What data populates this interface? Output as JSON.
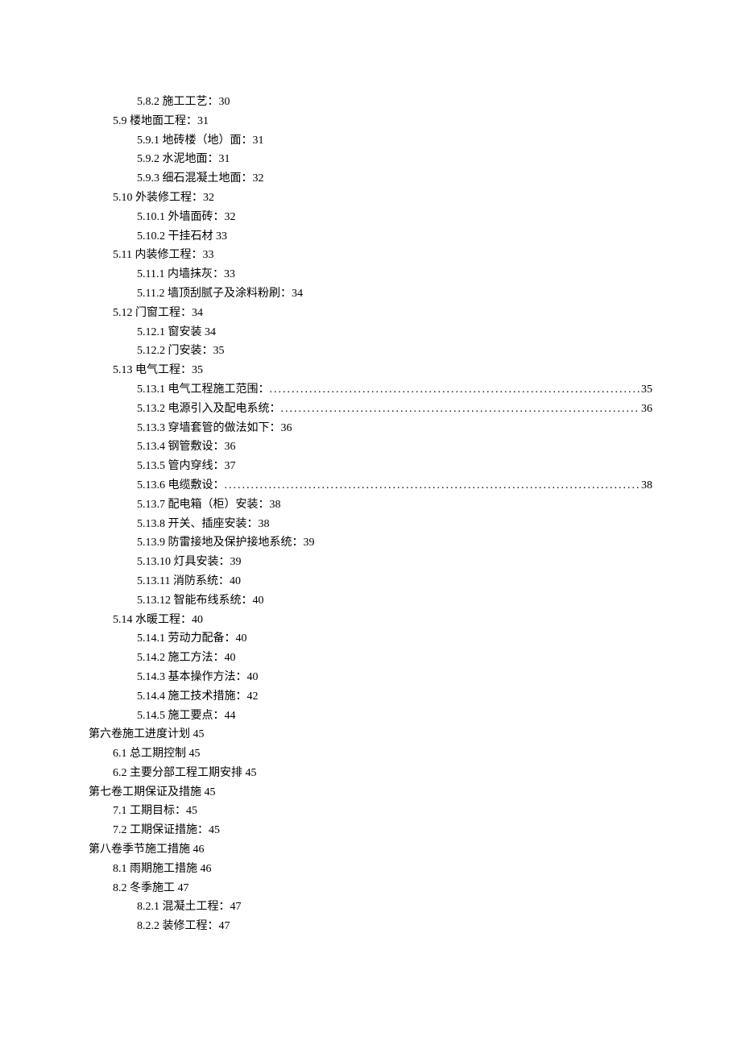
{
  "toc": [
    {
      "level": 2,
      "text": "5.8.2 施工工艺：30",
      "dotted": false,
      "page": ""
    },
    {
      "level": 1,
      "text": "5.9 楼地面工程：31",
      "dotted": false,
      "page": ""
    },
    {
      "level": 2,
      "text": "5.9.1 地砖楼（地）面：31",
      "dotted": false,
      "page": ""
    },
    {
      "level": 2,
      "text": "5.9.2 水泥地面：31",
      "dotted": false,
      "page": ""
    },
    {
      "level": 2,
      "text": "5.9.3 细石混凝土地面：32",
      "dotted": false,
      "page": ""
    },
    {
      "level": 1,
      "text": "5.10 外装修工程：32",
      "dotted": false,
      "page": ""
    },
    {
      "level": 2,
      "text": "5.10.1 外墙面砖：32",
      "dotted": false,
      "page": ""
    },
    {
      "level": 2,
      "text": "5.10.2 干挂石材 33",
      "dotted": false,
      "page": ""
    },
    {
      "level": 1,
      "text": "5.11 内装修工程：33",
      "dotted": false,
      "page": ""
    },
    {
      "level": 2,
      "text": "5.11.1 内墙抹灰：33",
      "dotted": false,
      "page": ""
    },
    {
      "level": 2,
      "text": "5.11.2 墙顶刮腻子及涂料粉刷：34",
      "dotted": false,
      "page": ""
    },
    {
      "level": 1,
      "text": "5.12 门窗工程：34",
      "dotted": false,
      "page": ""
    },
    {
      "level": 2,
      "text": "5.12.1 窗安装 34",
      "dotted": false,
      "page": ""
    },
    {
      "level": 2,
      "text": "5.12.2 门安装：35",
      "dotted": false,
      "page": ""
    },
    {
      "level": 1,
      "text": "5.13 电气工程：35",
      "dotted": false,
      "page": ""
    },
    {
      "level": 2,
      "text": "5.13.1 电气工程施工范围：",
      "dotted": true,
      "page": "35"
    },
    {
      "level": 2,
      "text": "5.13.2 电源引入及配电系统：",
      "dotted": true,
      "page": "36"
    },
    {
      "level": 2,
      "text": "5.13.3 穿墙套管的做法如下：36",
      "dotted": false,
      "page": ""
    },
    {
      "level": 2,
      "text": "5.13.4 钢管敷设：36",
      "dotted": false,
      "page": ""
    },
    {
      "level": 2,
      "text": "5.13.5 管内穿线：37",
      "dotted": false,
      "page": ""
    },
    {
      "level": 2,
      "text": "5.13.6 电缆敷设：",
      "dotted": true,
      "page": "38"
    },
    {
      "level": 2,
      "text": "5.13.7 配电箱（柜）安装：38",
      "dotted": false,
      "page": ""
    },
    {
      "level": 2,
      "text": "5.13.8 开关、插座安装：38",
      "dotted": false,
      "page": ""
    },
    {
      "level": 2,
      "text": "5.13.9 防雷接地及保护接地系统：39",
      "dotted": false,
      "page": ""
    },
    {
      "level": 2,
      "text": "5.13.10 灯具安装：39",
      "dotted": false,
      "page": ""
    },
    {
      "level": 2,
      "text": "5.13.11 消防系统：40",
      "dotted": false,
      "page": ""
    },
    {
      "level": 2,
      "text": "5.13.12 智能布线系统：40",
      "dotted": false,
      "page": ""
    },
    {
      "level": 1,
      "text": "5.14 水暖工程：40",
      "dotted": false,
      "page": ""
    },
    {
      "level": 2,
      "text": "5.14.1 劳动力配备：40",
      "dotted": false,
      "page": ""
    },
    {
      "level": 2,
      "text": "5.14.2 施工方法：40",
      "dotted": false,
      "page": ""
    },
    {
      "level": 2,
      "text": "5.14.3 基本操作方法：40",
      "dotted": false,
      "page": ""
    },
    {
      "level": 2,
      "text": "5.14.4 施工技术措施：42",
      "dotted": false,
      "page": ""
    },
    {
      "level": 2,
      "text": "5.14.5 施工要点：44",
      "dotted": false,
      "page": ""
    },
    {
      "level": 0,
      "text": "第六卷施工进度计划 45",
      "dotted": false,
      "page": ""
    },
    {
      "level": 1,
      "text": "6.1 总工期控制 45",
      "dotted": false,
      "page": ""
    },
    {
      "level": 1,
      "text": "6.2 主要分部工程工期安排 45",
      "dotted": false,
      "page": ""
    },
    {
      "level": 0,
      "text": "第七卷工期保证及措施 45",
      "dotted": false,
      "page": ""
    },
    {
      "level": 1,
      "text": "7.1 工期目标：45",
      "dotted": false,
      "page": ""
    },
    {
      "level": 1,
      "text": "7.2 工期保证措施：45",
      "dotted": false,
      "page": ""
    },
    {
      "level": 0,
      "text": "第八卷季节施工措施 46",
      "dotted": false,
      "page": ""
    },
    {
      "level": 1,
      "text": "8.1 雨期施工措施 46",
      "dotted": false,
      "page": ""
    },
    {
      "level": 1,
      "text": "8.2 冬季施工 47",
      "dotted": false,
      "page": ""
    },
    {
      "level": 2,
      "text": "8.2.1 混凝土工程：47",
      "dotted": false,
      "page": ""
    },
    {
      "level": 2,
      "text": "8.2.2 装修工程：47",
      "dotted": false,
      "page": ""
    }
  ]
}
